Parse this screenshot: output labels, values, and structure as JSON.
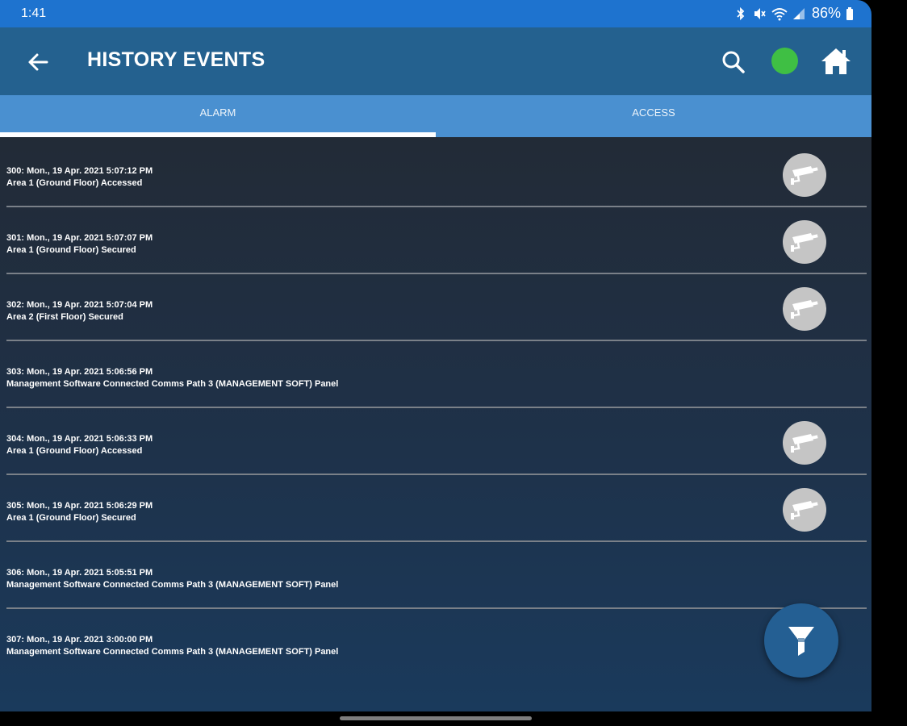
{
  "status_bar": {
    "time": "1:41",
    "battery": "86%"
  },
  "app_bar": {
    "title": "HISTORY EVENTS",
    "icons": [
      "back-arrow-icon",
      "search-icon",
      "status-dot",
      "home-icon"
    ],
    "status_color": "#3fbf44"
  },
  "tabs": [
    {
      "label": "ALARM",
      "selected": true
    },
    {
      "label": "ACCESS",
      "selected": false
    }
  ],
  "events": [
    {
      "line1": "300: Mon., 19 Apr. 2021 5:07:12 PM",
      "line2": "Area 1 (Ground Floor)  Accessed",
      "camera": true
    },
    {
      "line1": "301: Mon., 19 Apr. 2021 5:07:07 PM",
      "line2": "Area 1 (Ground Floor)  Secured",
      "camera": true
    },
    {
      "line1": "302: Mon., 19 Apr. 2021 5:07:04 PM",
      "line2": "Area 2 (First Floor)  Secured",
      "camera": true
    },
    {
      "line1": "303: Mon., 19 Apr. 2021 5:06:56 PM",
      "line2": "Management Software Connected Comms Path 3 (MANAGEMENT SOFT) Panel",
      "camera": false
    },
    {
      "line1": "304: Mon., 19 Apr. 2021 5:06:33 PM",
      "line2": "Area 1 (Ground Floor)  Accessed",
      "camera": true
    },
    {
      "line1": "305: Mon., 19 Apr. 2021 5:06:29 PM",
      "line2": "Area 1 (Ground Floor)  Secured",
      "camera": true
    },
    {
      "line1": "306: Mon., 19 Apr. 2021 5:05:51 PM",
      "line2": "Management Software Connected Comms Path 3 (MANAGEMENT SOFT) Panel",
      "camera": false
    },
    {
      "line1": "307: Mon., 19 Apr. 2021 3:00:00 PM",
      "line2": "Management Software Connected Comms Path 3 (MANAGEMENT SOFT) Panel",
      "camera": false
    }
  ],
  "fab": {
    "icon": "filter-icon"
  },
  "colors": {
    "status_bar": "#1e73cf",
    "app_bar": "#24618f",
    "tabs": "#4a90d0",
    "fab": "#245f93"
  }
}
